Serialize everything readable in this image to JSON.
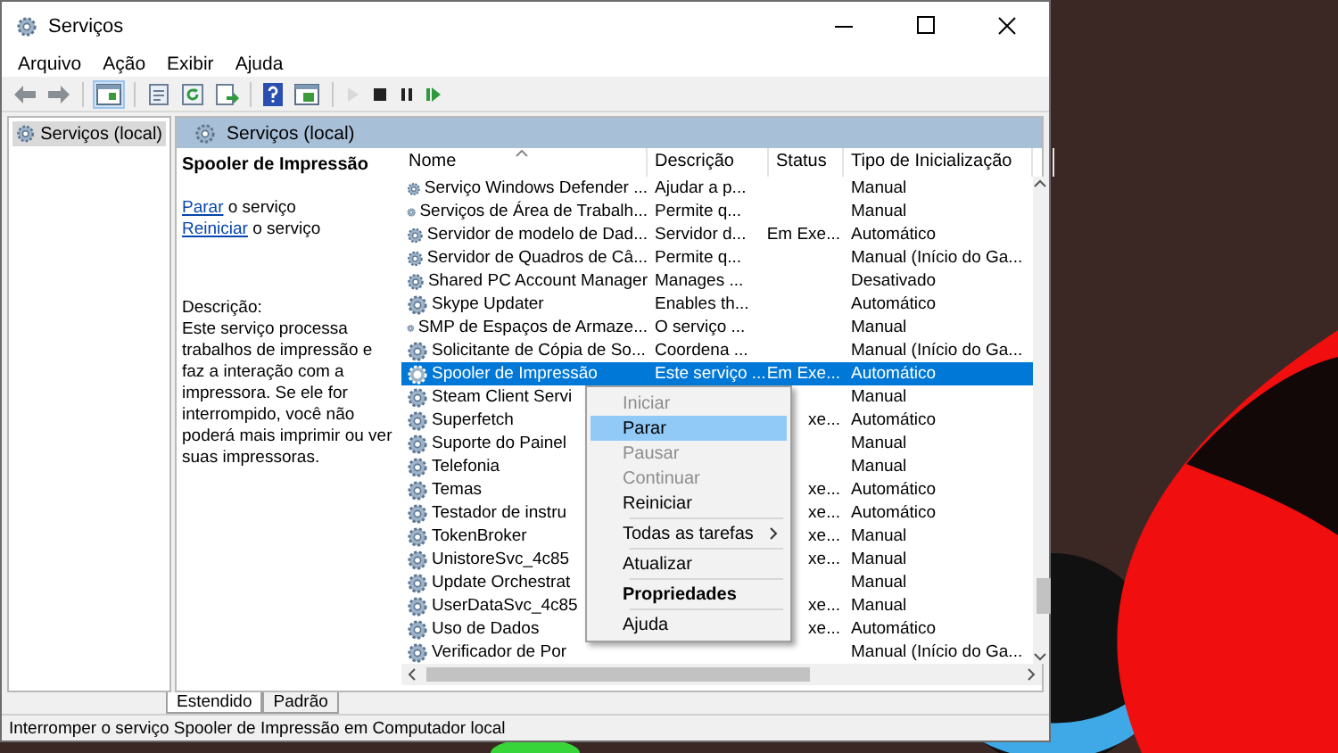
{
  "window": {
    "title": "Serviços"
  },
  "menu_bar": [
    "Arquivo",
    "Ação",
    "Exibir",
    "Ajuda"
  ],
  "toolbar": [
    {
      "kind": "back",
      "disabled": false
    },
    {
      "kind": "forward",
      "disabled": false
    },
    {
      "kind": "separator"
    },
    {
      "kind": "tree",
      "disabled": false
    },
    {
      "kind": "separator"
    },
    {
      "kind": "properties",
      "disabled": false
    },
    {
      "kind": "refresh",
      "disabled": false
    },
    {
      "kind": "export",
      "disabled": false
    },
    {
      "kind": "separator"
    },
    {
      "kind": "help",
      "disabled": false
    },
    {
      "kind": "view",
      "disabled": false
    },
    {
      "kind": "separator"
    },
    {
      "kind": "play",
      "disabled": true
    },
    {
      "kind": "stop",
      "disabled": false
    },
    {
      "kind": "pause",
      "disabled": false
    },
    {
      "kind": "restart",
      "disabled": false
    }
  ],
  "tree": {
    "items": [
      {
        "label": "Serviços (local)",
        "selected": true
      }
    ]
  },
  "pane_header": "Serviços (local)",
  "details": {
    "title": "Spooler de Impressão",
    "actions": [
      {
        "link": "Parar",
        "text": "o serviço"
      },
      {
        "link": "Reiniciar",
        "text": "o serviço"
      }
    ],
    "description_label": "Descrição:",
    "description": "Este serviço processa trabalhos de impressão e faz a interação com a impressora. Se ele for interrompido, você não poderá mais imprimir ou ver suas impressoras."
  },
  "table": {
    "columns": [
      "Nome",
      "Descrição",
      "Status",
      "Tipo de Inicialização"
    ],
    "rows": [
      {
        "name": "Serviço Windows Defender ...",
        "description": "Ajudar a p...",
        "startup": "Manual",
        "selected": false
      },
      {
        "name": "Serviços de Área de Trabalh...",
        "description": "Permite q...",
        "startup": "Manual",
        "selected": false
      },
      {
        "name": "Servidor de modelo de Dad...",
        "description": "Servidor d...",
        "status": "Em Exe...",
        "startup": "Automático",
        "selected": false
      },
      {
        "name": "Servidor de Quadros de Câ...",
        "description": "Permite q...",
        "startup": "Manual (Início do Ga...",
        "selected": false
      },
      {
        "name": "Shared PC Account Manager",
        "description": "Manages ...",
        "startup": "Desativado",
        "selected": false
      },
      {
        "name": "Skype Updater",
        "description": "Enables th...",
        "startup": "Automático",
        "selected": false
      },
      {
        "name": "SMP de Espaços de Armaze...",
        "description": "O serviço ...",
        "startup": "Manual",
        "selected": false
      },
      {
        "name": "Solicitante de Cópia de So...",
        "description": "Coordena ...",
        "startup": "Manual (Início do Ga...",
        "selected": false
      },
      {
        "name": "Spooler de Impressão",
        "description": "Este serviço ...",
        "status": "Em Exe...",
        "startup": "Automático",
        "selected": true
      },
      {
        "name": "Steam Client Servi",
        "startup": "Manual",
        "selected": false
      },
      {
        "name": "Superfetch",
        "status": "xe...",
        "startup": "Automático",
        "selected": false
      },
      {
        "name": "Suporte do Painel",
        "startup": "Manual",
        "selected": false
      },
      {
        "name": "Telefonia",
        "startup": "Manual",
        "selected": false
      },
      {
        "name": "Temas",
        "status": "xe...",
        "startup": "Automático",
        "selected": false
      },
      {
        "name": "Testador de instru",
        "status": "xe...",
        "startup": "Automático",
        "selected": false
      },
      {
        "name": "TokenBroker",
        "status": "xe...",
        "startup": "Manual",
        "selected": false
      },
      {
        "name": "UnistoreSvc_4c85",
        "status": "xe...",
        "startup": "Manual",
        "selected": false
      },
      {
        "name": "Update Orchestrat",
        "startup": "Manual",
        "selected": false
      },
      {
        "name": "UserDataSvc_4c85",
        "status": "xe...",
        "startup": "Manual",
        "selected": false
      },
      {
        "name": "Uso de Dados",
        "status": "xe...",
        "startup": "Automático",
        "selected": false
      },
      {
        "name": "Verificador de Por",
        "startup": "Manual (Início do Ga...",
        "selected": false
      }
    ]
  },
  "context_menu": [
    {
      "kind": "item",
      "label": "Iniciar",
      "disabled": true,
      "selected": false
    },
    {
      "kind": "item",
      "label": "Parar",
      "disabled": false,
      "selected": true
    },
    {
      "kind": "item",
      "label": "Pausar",
      "disabled": true,
      "selected": false
    },
    {
      "kind": "item",
      "label": "Continuar",
      "disabled": true,
      "selected": false
    },
    {
      "kind": "item",
      "label": "Reiniciar",
      "disabled": false,
      "selected": false
    },
    {
      "kind": "separator"
    },
    {
      "kind": "submenu",
      "label": "Todas as tarefas",
      "disabled": false,
      "selected": false
    },
    {
      "kind": "separator"
    },
    {
      "kind": "item",
      "label": "Atualizar",
      "disabled": false,
      "selected": false
    },
    {
      "kind": "separator"
    },
    {
      "kind": "default",
      "label": "Propriedades",
      "disabled": false,
      "selected": false
    },
    {
      "kind": "separator"
    },
    {
      "kind": "item",
      "label": "Ajuda",
      "disabled": false,
      "selected": false
    }
  ],
  "tabs": [
    {
      "label": "Estendido",
      "selected": true
    },
    {
      "label": "Padrão",
      "selected": false
    }
  ],
  "status_bar": "Interromper o serviço Spooler de Impressão em Computador local"
}
